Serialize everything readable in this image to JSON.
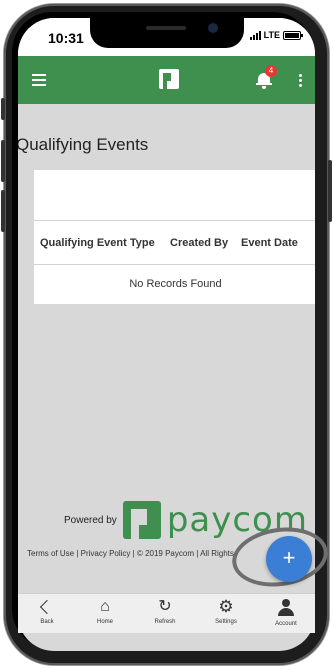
{
  "status_bar": {
    "time": "10:31",
    "network": "LTE"
  },
  "app_bar": {
    "notification_count": "4",
    "icons": [
      "menu-icon",
      "paycom-logo-icon",
      "bell-icon",
      "kebab-icon"
    ]
  },
  "page": {
    "title": "Qualifying Events"
  },
  "table": {
    "columns": [
      "Qualifying Event Type",
      "Created By",
      "Event Date"
    ],
    "empty_message": "No Records Found"
  },
  "footer": {
    "powered_by": "Powered by",
    "brand": "paycom",
    "legal": "Terms of Use | Privacy Policy | © 2019 Paycom | All Rights"
  },
  "fab": {
    "label": "+"
  },
  "bottom_nav": {
    "items": [
      {
        "label": "Back",
        "icon": "back-icon"
      },
      {
        "label": "Home",
        "icon": "home-icon"
      },
      {
        "label": "Refresh",
        "icon": "refresh-icon"
      },
      {
        "label": "Settings",
        "icon": "settings-icon"
      },
      {
        "label": "Account",
        "icon": "account-icon"
      }
    ]
  },
  "colors": {
    "brand_green": "#3f8f4f",
    "fab_blue": "#3b7ed6",
    "badge_red": "#e53935"
  }
}
